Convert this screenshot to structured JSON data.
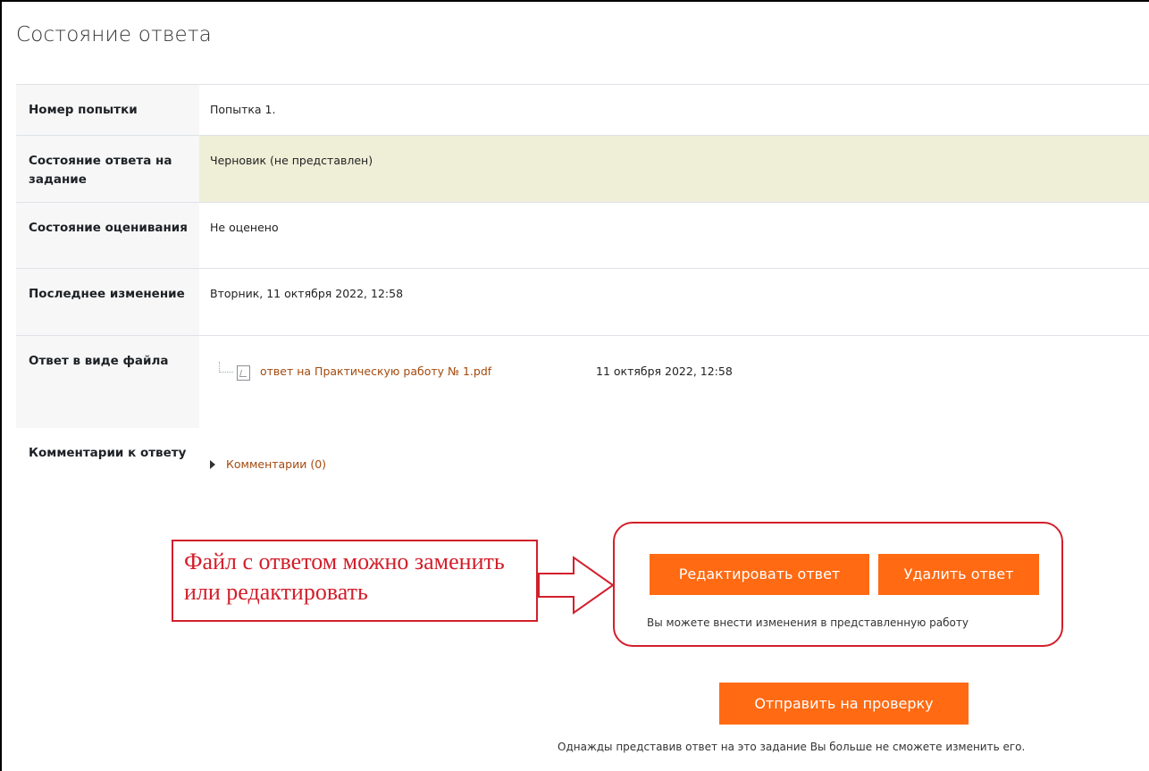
{
  "page": {
    "title": "Состояние ответа"
  },
  "rows": [
    {
      "label": "Номер попытки",
      "value": "Попытка 1."
    },
    {
      "label": "Состояние ответа на задание",
      "value": "Черновик (не представлен)"
    },
    {
      "label": "Состояние оценивания",
      "value": "Не оценено"
    },
    {
      "label": "Последнее изменение",
      "value": "Вторник, 11 октября 2022, 12:58"
    },
    {
      "label": "Ответ в виде файла"
    },
    {
      "label": "Комментарии к ответу"
    }
  ],
  "file": {
    "name": "ответ на Практическую работу № 1.pdf",
    "date": "11 октября 2022, 12:58",
    "icon": "pdf-file-icon"
  },
  "comments": {
    "link": "Комментарии (0)",
    "icon": "triangle-right-icon"
  },
  "annotation": {
    "text": "Файл с ответом можно заменить или редактировать",
    "color": "#d21f2b"
  },
  "actions": {
    "edit_label": "Редактировать ответ",
    "delete_label": "Удалить ответ",
    "edit_hint": "Вы можете внести изменения в представленную работу",
    "submit_label": "Отправить на проверку",
    "submit_hint": "Однажды представив ответ на это задание Вы больше не сможете изменить его.",
    "button_color": "#ff6a13"
  },
  "colors": {
    "draft_row_bg": "#efefd8",
    "link": "#a34a0e"
  }
}
